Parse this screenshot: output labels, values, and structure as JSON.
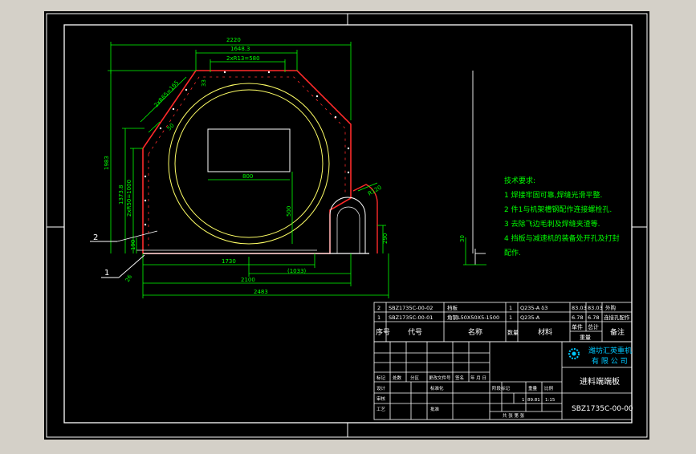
{
  "colors": {
    "background": "#d4d0c8",
    "sheet": "#000000",
    "frame": "#ffffff",
    "dimension": "#00ff00",
    "outline": "#ff2a2a",
    "circle": "#ffff66",
    "annotation": "#00ff00",
    "company": "#00c8ff"
  },
  "dimensions": {
    "overall_width_top": "2220",
    "top_width": "1648.3",
    "top_opening": "2xR13=580",
    "left_height": "1983",
    "left_inner_height": "1373.8",
    "left_chamfer_height": "2xR50=1000",
    "small_190": "190",
    "bottom_1730": "1730",
    "bottom_1033": "(1033)",
    "bottom_2100": "2100",
    "bottom_2483": "2483",
    "center_800": "800",
    "inner_500": "500",
    "right_290": "290",
    "angle_left": "2xR65=165",
    "angle_right": "R120",
    "small_30": "30",
    "small_33": "33",
    "small_26": "26",
    "small_50": "50"
  },
  "callouts": {
    "one": "1",
    "two": "2"
  },
  "technical_requirements": {
    "title": "技术要求:",
    "items": [
      "1 焊接牢固可靠,焊缝光滑平整.",
      "2 件1与机架槽钢配作连接螺栓孔.",
      "3 去除飞边毛刺及焊缝夹渣等.",
      "4 挡板与减速机的装备处开孔及打封",
      "配作."
    ]
  },
  "parts_list": {
    "rows": [
      {
        "no": "2",
        "code": "SBZ1735C-00-02",
        "name": "挡板",
        "qty": "1",
        "material": "Q235-A δ3",
        "unit_wt": "83.03",
        "total_wt": "83.03",
        "note": "外购"
      },
      {
        "no": "1",
        "code": "SBZ1735C-00-01",
        "name": "角钢L50X50X5-1500",
        "qty": "1",
        "material": "Q235-A",
        "unit_wt": "6.78",
        "total_wt": "6.78",
        "note": "连接孔配作"
      }
    ],
    "header": {
      "no": "序号",
      "code": "代号",
      "name": "名称",
      "qty": "数量",
      "material": "材料",
      "unit": "单件",
      "total": "总计",
      "weight": "重量",
      "note": "备注"
    }
  },
  "title_block": {
    "company_line1": "潍坊汇英重机",
    "company_line2": "有 限 公 司",
    "drawing_name": "进料端端板",
    "drawing_number": "SBZ1735C-00-00",
    "scale": "1:15",
    "weight": "89.81",
    "count": "1",
    "labels": {
      "mark": "标记",
      "qty": "处数",
      "zone": "分区",
      "change_doc": "更改文件号",
      "signature": "签名",
      "date": "年 月 日",
      "design": "设计",
      "standardize": "标准化",
      "check": "审核",
      "process": "工艺",
      "approve": "批准",
      "stage_mark": "阶段标记",
      "weight_label": "重量",
      "scale_label": "比例",
      "sheets": "共 张 第 张"
    }
  }
}
